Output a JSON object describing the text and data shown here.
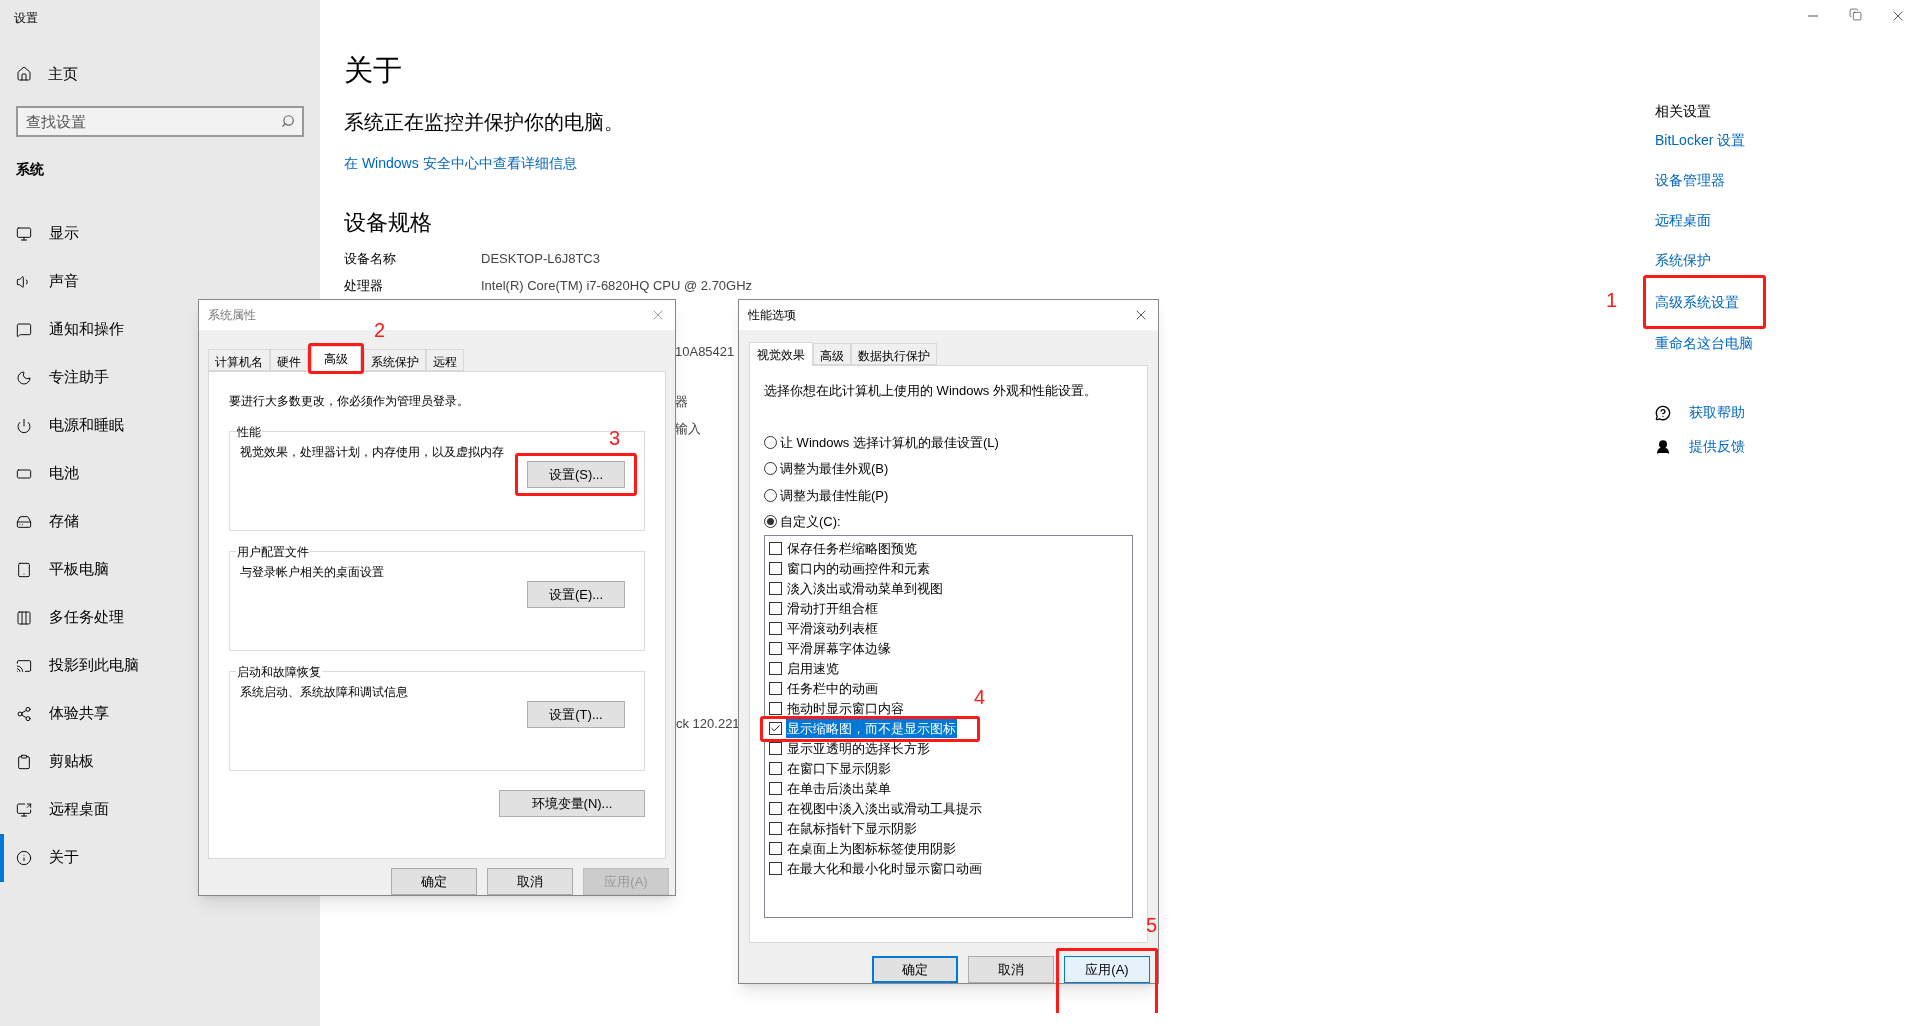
{
  "window": {
    "title": "设置"
  },
  "sidebar": {
    "home": "主页",
    "search": {
      "placeholder": "查找设置"
    },
    "section": "系统",
    "items": [
      {
        "label": "显示",
        "selected": false
      },
      {
        "label": "声音",
        "selected": false
      },
      {
        "label": "通知和操作",
        "selected": false
      },
      {
        "label": "专注助手",
        "selected": false
      },
      {
        "label": "电源和睡眠",
        "selected": false
      },
      {
        "label": "电池",
        "selected": false
      },
      {
        "label": "存储",
        "selected": false
      },
      {
        "label": "平板电脑",
        "selected": false
      },
      {
        "label": "多任务处理",
        "selected": false
      },
      {
        "label": "投影到此电脑",
        "selected": false
      },
      {
        "label": "体验共享",
        "selected": false
      },
      {
        "label": "剪贴板",
        "selected": false
      },
      {
        "label": "远程桌面",
        "selected": false
      },
      {
        "label": "关于",
        "selected": true
      }
    ]
  },
  "page": {
    "title": "关于",
    "status": "系统正在监控并保护你的电脑。",
    "security_link": "在 Windows 安全中心中查看详细信息",
    "specs_heading": "设备规格",
    "specs": [
      {
        "label": "设备名称",
        "value": "DESKTOP-L6J8TC3"
      },
      {
        "label": "处理器",
        "value": "Intel(R) Core(TM) i7-6820HQ CPU @ 2.70GHz"
      }
    ],
    "obscured_fragments": [
      "10A85421",
      "器",
      "输入",
      "ck 120.221"
    ]
  },
  "related": {
    "heading": "相关设置",
    "links": [
      "BitLocker 设置",
      "设备管理器",
      "远程桌面",
      "系统保护",
      "高级系统设置",
      "重命名这台电脑"
    ],
    "support": [
      "获取帮助",
      "提供反馈"
    ]
  },
  "system_properties": {
    "title": "系统属性",
    "tabs": [
      {
        "label": "计算机名",
        "selected": false
      },
      {
        "label": "硬件",
        "selected": false
      },
      {
        "label": "高级",
        "selected": true
      },
      {
        "label": "系统保护",
        "selected": false
      },
      {
        "label": "远程",
        "selected": false
      }
    ],
    "notice": "要进行大多数更改，你必须作为管理员登录。",
    "groups": [
      {
        "title": "性能",
        "description": "视觉效果，处理器计划，内存使用，以及虚拟内存",
        "button": "设置(S)..."
      },
      {
        "title": "用户配置文件",
        "description": "与登录帐户相关的桌面设置",
        "button": "设置(E)..."
      },
      {
        "title": "启动和故障恢复",
        "description": "系统启动、系统故障和调试信息",
        "button": "设置(T)..."
      }
    ],
    "env_button": "环境变量(N)...",
    "buttons": [
      {
        "label": "确定",
        "disabled": false
      },
      {
        "label": "取消",
        "disabled": false
      },
      {
        "label": "应用(A)",
        "disabled": true
      }
    ]
  },
  "performance_options": {
    "title": "性能选项",
    "tabs": [
      {
        "label": "视觉效果",
        "selected": true
      },
      {
        "label": "高级",
        "selected": false
      },
      {
        "label": "数据执行保护",
        "selected": false
      }
    ],
    "prompt": "选择你想在此计算机上使用的 Windows 外观和性能设置。",
    "options": [
      {
        "label": "让 Windows 选择计算机的最佳设置(L)",
        "selected": false
      },
      {
        "label": "调整为最佳外观(B)",
        "selected": false
      },
      {
        "label": "调整为最佳性能(P)",
        "selected": false
      },
      {
        "label": "自定义(C):",
        "selected": true
      }
    ],
    "effects": [
      {
        "label": "保存任务栏缩略图预览",
        "checked": false,
        "selected": false
      },
      {
        "label": "窗口内的动画控件和元素",
        "checked": false,
        "selected": false
      },
      {
        "label": "淡入淡出或滑动菜单到视图",
        "checked": false,
        "selected": false
      },
      {
        "label": "滑动打开组合框",
        "checked": false,
        "selected": false
      },
      {
        "label": "平滑滚动列表框",
        "checked": false,
        "selected": false
      },
      {
        "label": "平滑屏幕字体边缘",
        "checked": false,
        "selected": false
      },
      {
        "label": "启用速览",
        "checked": false,
        "selected": false
      },
      {
        "label": "任务栏中的动画",
        "checked": false,
        "selected": false
      },
      {
        "label": "拖动时显示窗口内容",
        "checked": false,
        "selected": false
      },
      {
        "label": "显示缩略图，而不是显示图标",
        "checked": true,
        "selected": true
      },
      {
        "label": "显示亚透明的选择长方形",
        "checked": false,
        "selected": false
      },
      {
        "label": "在窗口下显示阴影",
        "checked": false,
        "selected": false
      },
      {
        "label": "在单击后淡出菜单",
        "checked": false,
        "selected": false
      },
      {
        "label": "在视图中淡入淡出或滑动工具提示",
        "checked": false,
        "selected": false
      },
      {
        "label": "在鼠标指针下显示阴影",
        "checked": false,
        "selected": false
      },
      {
        "label": "在桌面上为图标标签使用阴影",
        "checked": false,
        "selected": false
      },
      {
        "label": "在最大化和最小化时显示窗口动画",
        "checked": false,
        "selected": false
      }
    ],
    "buttons": [
      {
        "label": "确定",
        "default": true,
        "hovered": false
      },
      {
        "label": "取消",
        "default": false,
        "hovered": false
      },
      {
        "label": "应用(A)",
        "default": false,
        "hovered": true
      }
    ]
  },
  "annotations": [
    "1",
    "2",
    "3",
    "4",
    "5"
  ]
}
